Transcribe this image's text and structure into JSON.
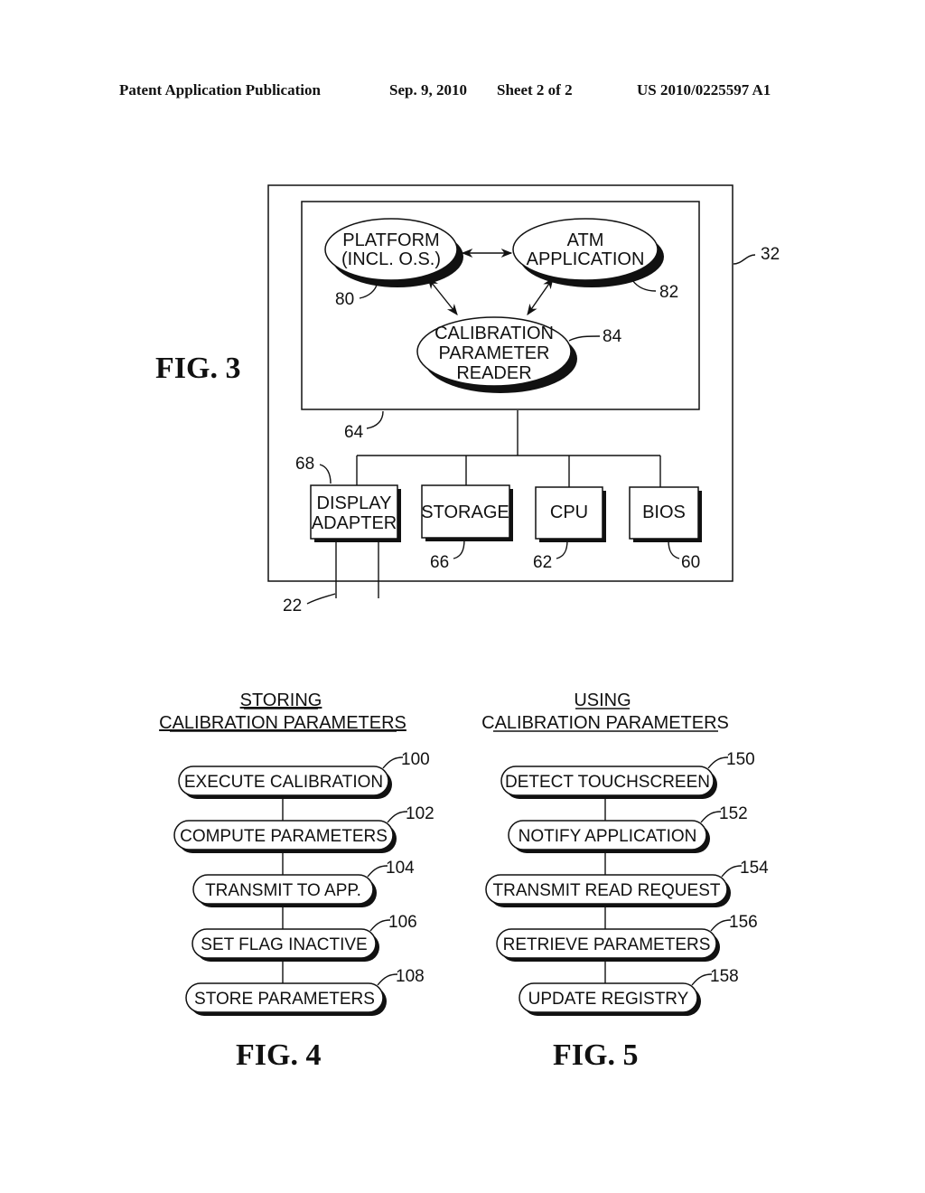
{
  "header": {
    "publication": "Patent Application Publication",
    "date": "Sep. 9, 2010",
    "sheet": "Sheet 2 of 2",
    "number": "US 2010/0225597 A1"
  },
  "fig3": {
    "title": "FIG. 3",
    "outer_ref": "32",
    "inner_ref": "64",
    "nodes": {
      "platform": {
        "lines": [
          "PLATFORM",
          "(INCL. O.S.)"
        ],
        "ref": "80"
      },
      "atm": {
        "lines": [
          "ATM",
          "APPLICATION"
        ],
        "ref": "82"
      },
      "calib": {
        "lines": [
          "CALIBRATION",
          "PARAMETER",
          "READER"
        ],
        "ref": "84"
      }
    },
    "components": [
      {
        "lines": [
          "DISPLAY",
          "ADAPTER"
        ],
        "ref": "68"
      },
      {
        "lines": [
          "STORAGE"
        ],
        "ref": "66"
      },
      {
        "lines": [
          "CPU"
        ],
        "ref": "62"
      },
      {
        "lines": [
          "BIOS"
        ],
        "ref": "60"
      }
    ],
    "cable_ref": "22"
  },
  "fig4": {
    "title": "FIG. 4",
    "heading": [
      "STORING",
      "CALIBRATION PARAMETERS"
    ],
    "steps": [
      {
        "label": "EXECUTE CALIBRATION",
        "ref": "100"
      },
      {
        "label": "COMPUTE PARAMETERS",
        "ref": "102"
      },
      {
        "label": "TRANSMIT TO APP.",
        "ref": "104"
      },
      {
        "label": "SET FLAG INACTIVE",
        "ref": "106"
      },
      {
        "label": "STORE PARAMETERS",
        "ref": "108"
      }
    ]
  },
  "fig5": {
    "title": "FIG. 5",
    "heading": [
      "USING",
      "CALIBRATION PARAMETERS"
    ],
    "steps": [
      {
        "label": "DETECT TOUCHSCREEN",
        "ref": "150"
      },
      {
        "label": "NOTIFY APPLICATION",
        "ref": "152"
      },
      {
        "label": "TRANSMIT READ REQUEST",
        "ref": "154"
      },
      {
        "label": "RETRIEVE PARAMETERS",
        "ref": "156"
      },
      {
        "label": "UPDATE REGISTRY",
        "ref": "158"
      }
    ]
  }
}
